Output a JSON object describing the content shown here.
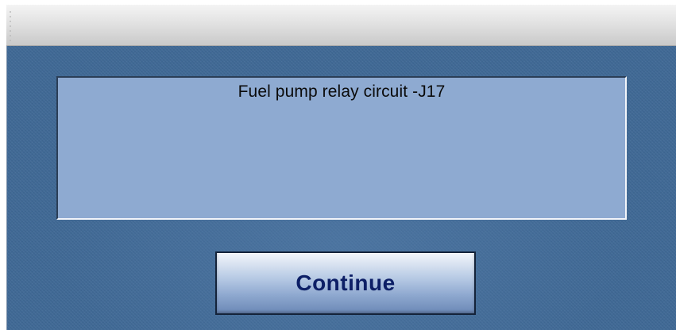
{
  "dialog": {
    "message": "Fuel pump relay circuit -J17",
    "continue_label": "Continue"
  },
  "colors": {
    "background": "#3f6a98",
    "panel": "#8eaad1",
    "button_text": "#0d1f66"
  }
}
